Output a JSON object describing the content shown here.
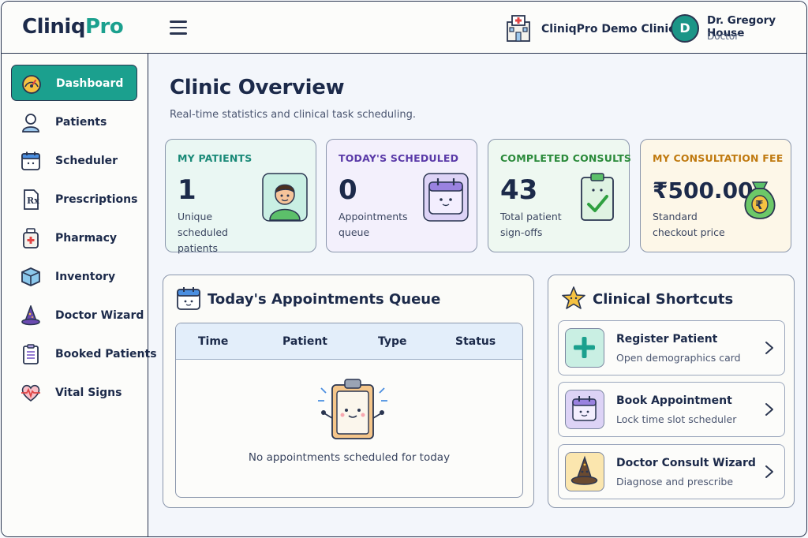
{
  "header": {
    "logo_part1": "Cliniq",
    "logo_part2": "Pro",
    "clinic_name": "CliniqPro Demo Clinic",
    "user": {
      "initial": "D",
      "name": "Dr. Gregory House",
      "role": "Doctor"
    }
  },
  "sidebar": {
    "items": [
      {
        "label": "Dashboard",
        "icon": "speedometer-icon",
        "active": true
      },
      {
        "label": "Patients",
        "icon": "patient-icon"
      },
      {
        "label": "Scheduler",
        "icon": "calendar-icon"
      },
      {
        "label": "Prescriptions",
        "icon": "prescription-icon"
      },
      {
        "label": "Pharmacy",
        "icon": "medicine-bottle-icon"
      },
      {
        "label": "Inventory",
        "icon": "box-icon"
      },
      {
        "label": "Doctor Wizard",
        "icon": "wizard-hat-icon"
      },
      {
        "label": "Booked Patients",
        "icon": "clipboard-list-icon"
      },
      {
        "label": "Vital Signs",
        "icon": "heartbeat-icon"
      }
    ]
  },
  "main": {
    "title": "Clinic Overview",
    "subtitle": "Real-time statistics and clinical task scheduling.",
    "stats": [
      {
        "label": "MY PATIENTS",
        "value": "1",
        "desc": "Unique scheduled patients",
        "icon": "patient-avatar-icon",
        "color": "#1b8a78"
      },
      {
        "label": "TODAY'S SCHEDULED",
        "value": "0",
        "desc": "Appointments queue",
        "icon": "calendar-face-icon",
        "color": "#5a3aa8"
      },
      {
        "label": "COMPLETED CONSULTS",
        "value": "43",
        "desc": "Total patient sign-offs",
        "icon": "clipboard-check-icon",
        "color": "#2a8a3a"
      },
      {
        "label": "MY CONSULTATION FEE",
        "value": "₹500.00",
        "desc": "Standard checkout price",
        "icon": "money-bag-icon",
        "color": "#c07a10"
      }
    ],
    "queue": {
      "title": "Today's Appointments Queue",
      "columns": [
        "Time",
        "Patient",
        "Type",
        "Status"
      ],
      "empty_text": "No appointments scheduled for today"
    },
    "shortcuts": {
      "title": "Clinical Shortcuts",
      "items": [
        {
          "title": "Register Patient",
          "sub": "Open demographics card",
          "icon": "plus-icon"
        },
        {
          "title": "Book Appointment",
          "sub": "Lock time slot scheduler",
          "icon": "calendar-face-icon"
        },
        {
          "title": "Doctor Consult Wizard",
          "sub": "Diagnose and prescribe",
          "icon": "wizard-hat-icon"
        }
      ]
    }
  },
  "colors": {
    "accent": "#1ba08e",
    "navy": "#1c2a4a",
    "stat_bg_1": "#eaf7f3",
    "stat_bg_2": "#f3f0fc",
    "stat_bg_3": "#eef8f1",
    "stat_bg_4": "#fdf7e8"
  }
}
